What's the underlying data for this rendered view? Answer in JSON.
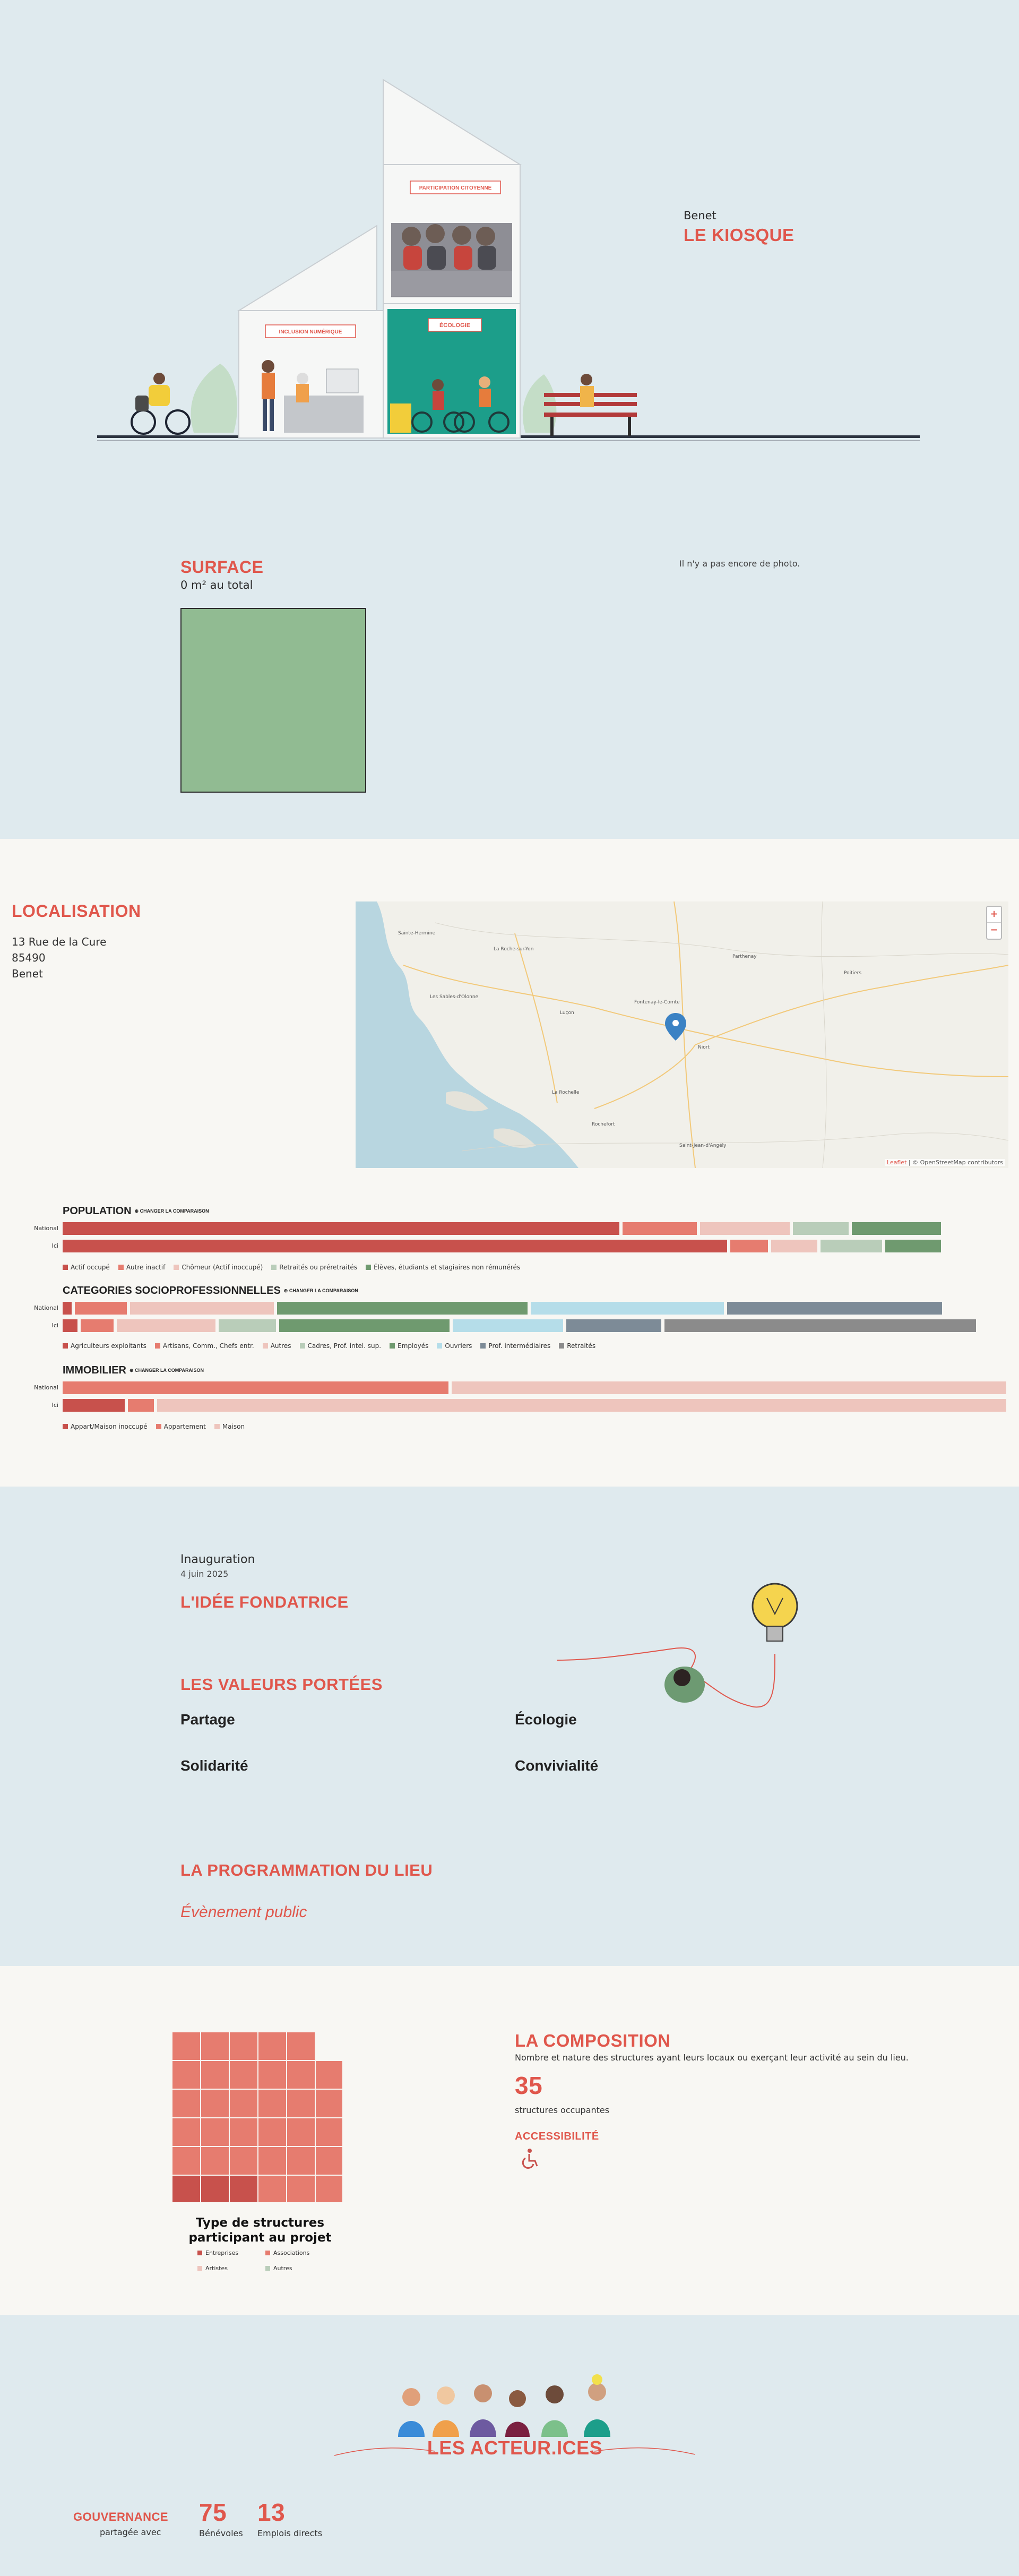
{
  "hero": {
    "city": "Benet",
    "title": "LE KIOSQUE",
    "labels": {
      "participation": "PARTICIPATION CITOYENNE",
      "inclusion": "INCLUSION NUMÉRIQUE",
      "ecologie": "ÉCOLOGIE"
    }
  },
  "surface": {
    "title": "SURFACE",
    "value": "0 m² au total",
    "no_photo": "Il n'y a pas encore de photo."
  },
  "localisation": {
    "title": "LOCALISATION",
    "address_line1": "13 Rue de la Cure",
    "postcode": "85490",
    "city": "Benet",
    "map": {
      "zoom_in": "+",
      "zoom_out": "−",
      "attribution_leaflet": "Leaflet",
      "attribution_osm": "| © OpenStreetMap contributors",
      "places": [
        "Sainte-Hermine",
        "La Roche-sur-Yon",
        "Parthenay",
        "Poitiers",
        "Les Sables-d'Olonne",
        "Luçon",
        "Fontenay-le-Comte",
        "Niort",
        "La Rochelle",
        "Rochefort",
        "Saint-Jean-d'Angély"
      ]
    }
  },
  "stats": {
    "compare_label": "⊕ CHANGER LA COMPARAISON",
    "row_national": "National",
    "row_local": "Ici",
    "population": {
      "title": "POPULATION",
      "legend": [
        {
          "label": "Actif occupé",
          "color": "#c8514c"
        },
        {
          "label": "Autre inactif",
          "color": "#e67c6f"
        },
        {
          "label": "Chômeur (Actif inoccupé)",
          "color": "#eec5bd"
        },
        {
          "label": "Retraités ou préretraités",
          "color": "#b9cdb9"
        },
        {
          "label": "Élèves, étudiants et stagiaires non rémunérés",
          "color": "#6f9a6f"
        }
      ],
      "national": [
        0.598,
        0.08,
        0.096,
        0.06,
        0.096
      ],
      "local": [
        0.714,
        0.04,
        0.05,
        0.066,
        0.06
      ]
    },
    "csp": {
      "title": "CATEGORIES SOCIOPROFESSIONNELLES",
      "legend": [
        {
          "label": "Agriculteurs exploitants",
          "color": "#c8514c"
        },
        {
          "label": "Artisans, Comm., Chefs entr.",
          "color": "#e67c6f"
        },
        {
          "label": "Autres",
          "color": "#eec5bd"
        },
        {
          "label": "Cadres, Prof. intel. sup.",
          "color": "#b9cdb9"
        },
        {
          "label": "Employés",
          "color": "#6f9a6f"
        },
        {
          "label": "Ouvriers",
          "color": "#b5dde9"
        },
        {
          "label": "Prof. intermédiaires",
          "color": "#7d8b97"
        },
        {
          "label": "Retraités",
          "color": "#8b8b8b"
        }
      ],
      "national": [
        0.01,
        0.056,
        0.155,
        0,
        0.27,
        0.208,
        0.232,
        0
      ],
      "local": [
        0.016,
        0.036,
        0.107,
        0.062,
        0.185,
        0.12,
        0.103,
        0.338
      ]
    },
    "immobilier": {
      "title": "IMMOBILIER",
      "legend": [
        {
          "label": "Appart/Maison inoccupé",
          "color": "#c8514c"
        },
        {
          "label": "Appartement",
          "color": "#e67c6f"
        },
        {
          "label": "Maison",
          "color": "#eec5bd"
        }
      ],
      "national": [
        0,
        0.41,
        0.59
      ],
      "local": [
        0.066,
        0.028,
        0.906
      ]
    }
  },
  "idea": {
    "inauguration_label": "Inauguration",
    "inauguration_date": "4 juin 2025",
    "title": "L'IDÉE FONDATRICE",
    "values_title": "LES VALEURS PORTÉES",
    "values": [
      "Partage",
      "Écologie",
      "Solidarité",
      "Convivialité"
    ],
    "programme_title": "LA PROGRAMMATION DU LIEU",
    "programme_item": "Évènement public"
  },
  "composition": {
    "title": "LA COMPOSITION",
    "description": "Nombre et nature des structures ayant leurs locaux ou exerçant leur activité au sein du lieu.",
    "count": "35",
    "count_label": "structures occupantes",
    "accessibility_title": "ACCESSIBILITÉ",
    "chart_title": "Type de structures participant au projet",
    "legend": [
      {
        "label": "Entreprises",
        "color": "#c8514c"
      },
      {
        "label": "Associations",
        "color": "#e67c6f"
      },
      {
        "label": "Artistes",
        "color": "#eec5bd"
      },
      {
        "label": "Autres",
        "color": "#b9cdb9"
      }
    ]
  },
  "acteurs": {
    "title": "LES ACTEUR.ICES",
    "gouvernance": "GOUVERNANCE",
    "gouvernance_sub": "partagée avec",
    "benevoles_count": "75",
    "benevoles_label": "Bénévoles",
    "emplois_count": "13",
    "emplois_label": "Emplois directs"
  },
  "chart_data": {
    "type": "waffle",
    "title": "Type de structures participant au projet",
    "total": 35,
    "series": [
      {
        "name": "Entreprises",
        "value": 3
      },
      {
        "name": "Associations",
        "value": 32
      },
      {
        "name": "Artistes",
        "value": 0
      },
      {
        "name": "Autres",
        "value": 0
      }
    ]
  }
}
